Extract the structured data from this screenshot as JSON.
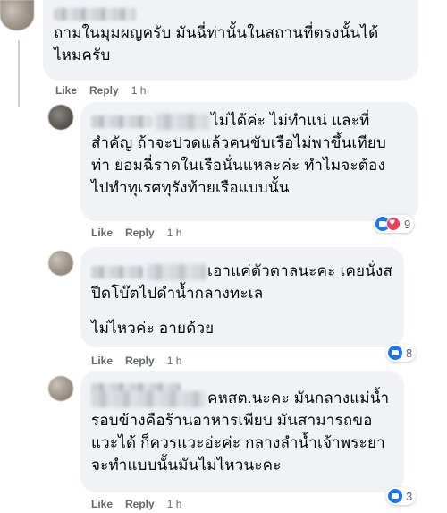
{
  "comments": [
    {
      "text_lines": [
        "ถามในมุมผญครับ มันฉี่ท่านั้นในสถานที่ตรงนั้นได้",
        "ไหมครับ"
      ],
      "like_label": "Like",
      "reply_label": "Reply",
      "time": "1 h"
    },
    {
      "text_lines": [
        "ไม่ได้ค่ะ ไม่ทำแน่ และที่",
        "สำคัญ ถ้าจะปวดแล้วคนขับเรือไม่พาขึ้นเทียบ",
        "ท่า ยอมฉี่ราดในเรือนั่นแหละค่ะ ทำไมจะต้อง",
        "ไปทำทุเรศทุรังท้ายเรือแบบนั้น"
      ],
      "like_label": "Like",
      "reply_label": "Reply",
      "time": "1 h",
      "reaction_count": "9"
    },
    {
      "text_lines": [
        "เอาแค่ตัวตาลนะคะ เคยนั่งส",
        "ปีดโบ๊ตไปดำน้ำกลางทะเล"
      ],
      "text_extra": "ไม่ไหวค่ะ อายด้วย",
      "like_label": "Like",
      "reply_label": "Reply",
      "time": "1 h",
      "reaction_count": "8"
    },
    {
      "text_lines": [
        "คหสต.นะคะ มันกลางแม่น้ำ",
        "รอบข้างคือร้านอาหารเพียบ มันสามารถขอ",
        "แวะได้ ก็ควรแวะอ่ะค่ะ กลางลำน้ำเจ้าพระยา",
        "จะทำแบบนั้นมันไม่ไหวนะคะ"
      ],
      "like_label": "Like",
      "reply_label": "Reply",
      "time": "1 h",
      "reaction_count": "3"
    }
  ],
  "colors": {
    "bubble": "#f0f2f5",
    "action_text": "#65676b",
    "like_blue": "#1877f2",
    "love_red": "#f33e58"
  }
}
